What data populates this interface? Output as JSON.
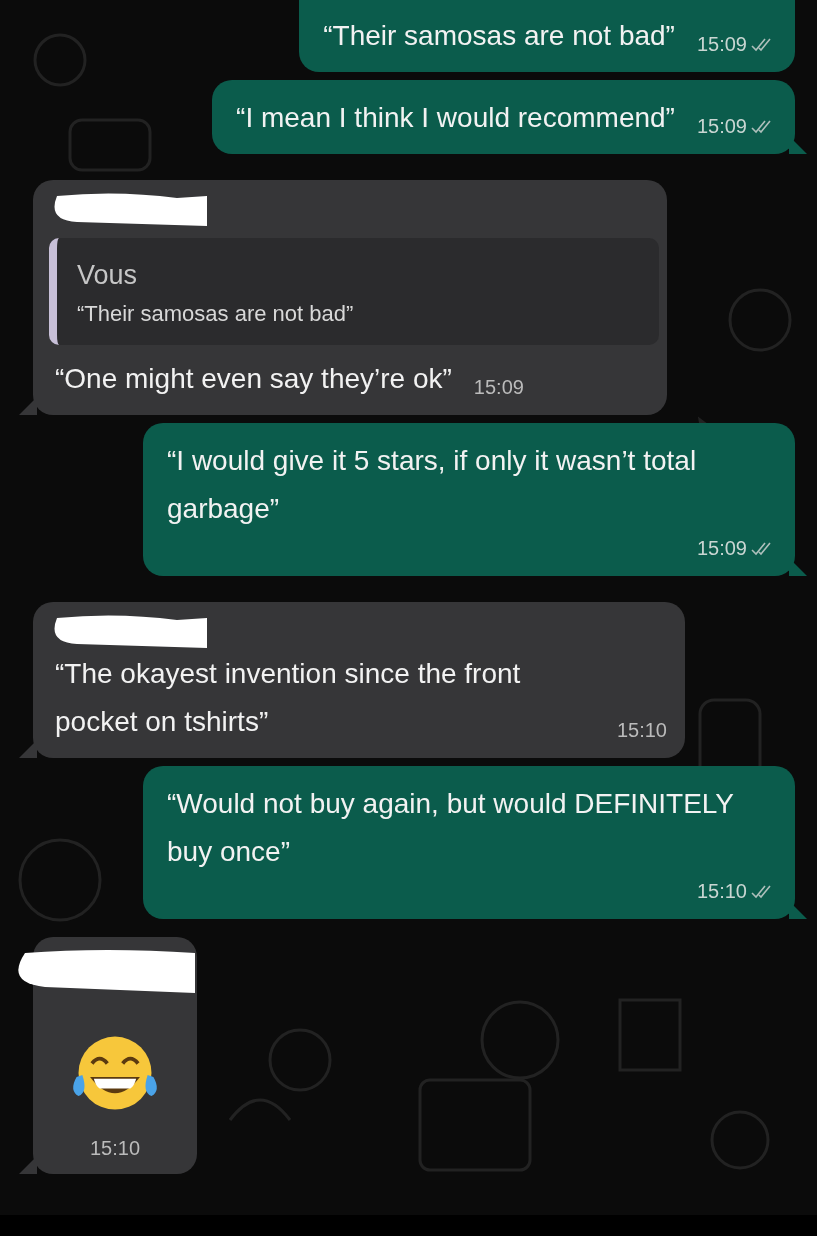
{
  "messages": [
    {
      "kind": "out",
      "text": "“Their samosas are not bad”",
      "time": "15:09",
      "delivered": true,
      "tail": false
    },
    {
      "kind": "out",
      "text": "“I mean I think I would recommend”",
      "time": "15:09",
      "delivered": true,
      "tail": true
    },
    {
      "kind": "in",
      "sender_redacted": true,
      "quote": {
        "author": "Vous",
        "text": "“Their samosas are not bad”"
      },
      "text": "“One might even say they’re ok”",
      "time": "15:09",
      "tail": true
    },
    {
      "kind": "out",
      "text": "“I would give it 5 stars, if only it wasn’t total garbage”",
      "time": "15:09",
      "delivered": true,
      "tail": true
    },
    {
      "kind": "in",
      "sender_redacted": true,
      "text": "“The okayest invention since the front pocket on tshirts”",
      "time": "15:10",
      "tail": true
    },
    {
      "kind": "out",
      "text": "“Would not buy again, but would DEFINITELY buy once”",
      "time": "15:10",
      "delivered": true,
      "tail": true
    },
    {
      "kind": "emoji",
      "sender_redacted": true,
      "time": "15:10",
      "tail": true
    }
  ]
}
